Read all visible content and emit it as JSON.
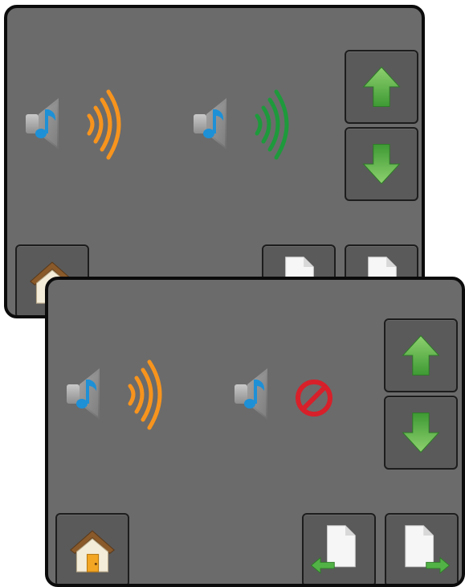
{
  "screens": [
    {
      "name": "audio-settings-before",
      "speakers": [
        {
          "icon": "speaker-volume-icon",
          "wave_color": "#f7941d"
        },
        {
          "icon": "speaker-volume-icon",
          "wave_color": "#1e9a3c"
        }
      ],
      "buttons": [
        "arrow-up-icon",
        "arrow-down-icon",
        "home-icon",
        "page-icon",
        "page-icon"
      ]
    },
    {
      "name": "audio-settings-after",
      "speakers": [
        {
          "icon": "speaker-volume-icon",
          "wave_color": "#f7941d"
        },
        {
          "icon": "speaker-muted-icon",
          "mute_color": "#d7202a"
        }
      ],
      "buttons": [
        "arrow-up-icon",
        "arrow-down-icon",
        "home-icon",
        "page-previous-icon",
        "page-next-icon"
      ]
    }
  ],
  "colors": {
    "panel": "#6b6b6b",
    "button": "#5a5a5a",
    "arrow": "#52b246",
    "note": "#1e90d6"
  }
}
